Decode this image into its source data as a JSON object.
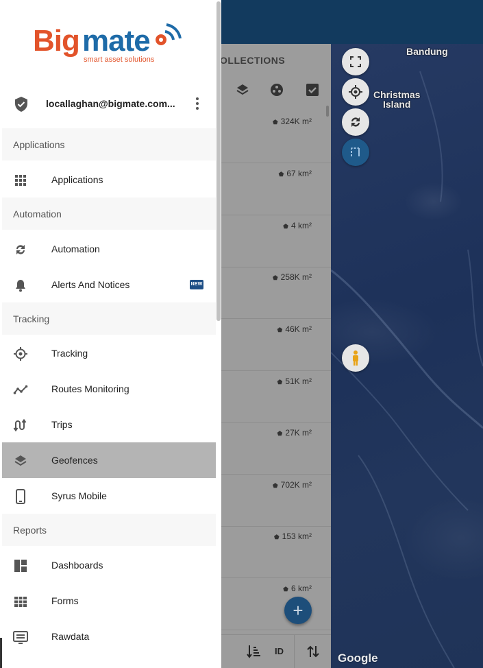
{
  "brand": {
    "name": "Bigmate",
    "tagline": "smart asset solutions",
    "colors": {
      "primary": "#e2532a",
      "secondary": "#1e6ba8"
    }
  },
  "user": {
    "email": "locallaghan@bigmate.com..."
  },
  "drawer": {
    "sections": [
      {
        "title": "Applications",
        "items": [
          {
            "label": "Applications",
            "icon": "grid-icon"
          }
        ]
      },
      {
        "title": "Automation",
        "items": [
          {
            "label": "Automation",
            "icon": "sync-icon"
          },
          {
            "label": "Alerts And Notices",
            "icon": "bell-icon",
            "badge": "NEW"
          }
        ]
      },
      {
        "title": "Tracking",
        "items": [
          {
            "label": "Tracking",
            "icon": "crosshair-icon"
          },
          {
            "label": "Routes Monitoring",
            "icon": "route-icon"
          },
          {
            "label": "Trips",
            "icon": "trips-icon"
          },
          {
            "label": "Geofences",
            "icon": "layers-icon",
            "selected": true
          },
          {
            "label": "Syrus Mobile",
            "icon": "phone-icon"
          }
        ]
      },
      {
        "title": "Reports",
        "items": [
          {
            "label": "Dashboards",
            "icon": "dashboard-icon"
          },
          {
            "label": "Forms",
            "icon": "table-grid-icon"
          },
          {
            "label": "Rawdata",
            "icon": "monitor-icon"
          }
        ]
      }
    ]
  },
  "collections": {
    "title": "OLLECTIONS",
    "areas": [
      "324K m²",
      "67 km²",
      "4 km²",
      "258K m²",
      "46K m²",
      "51K m²",
      "27K m²",
      "702K m²",
      "153 km²",
      "6 km²"
    ],
    "sort_label": "ID"
  },
  "map": {
    "labels": {
      "bandung": "Bandung",
      "christmas_island": "Christmas\nIsland"
    },
    "attribution": "Google"
  }
}
